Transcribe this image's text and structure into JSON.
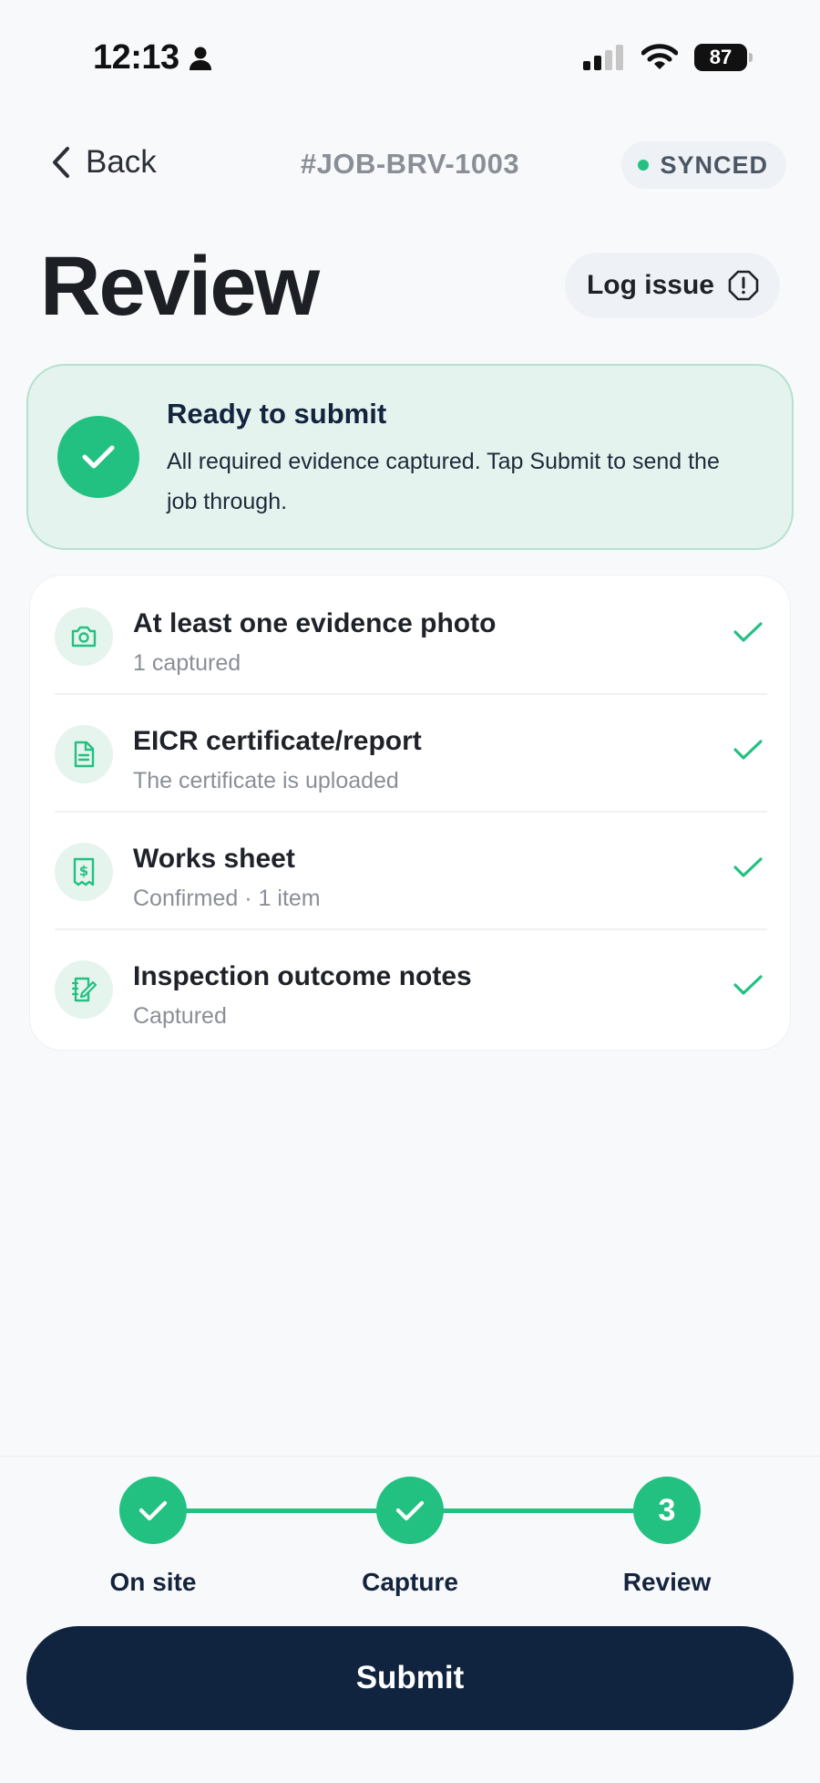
{
  "status_bar": {
    "time": "12:13",
    "battery": "87"
  },
  "header": {
    "back_label": "Back",
    "job_id": "#JOB-BRV-1003",
    "sync_status": "SYNCED",
    "title": "Review",
    "log_issue_label": "Log issue"
  },
  "banner": {
    "title": "Ready to submit",
    "body": "All required evidence captured. Tap Submit to send the job through."
  },
  "checklist": [
    {
      "label": "At least one evidence photo",
      "sub": "1 captured",
      "icon": "camera-icon",
      "done": true
    },
    {
      "label": "EICR certificate/report",
      "sub": "The certificate is uploaded",
      "icon": "document-icon",
      "done": true
    },
    {
      "label": "Works sheet",
      "sub": "Confirmed · 1 item",
      "icon": "receipt-icon",
      "done": true
    },
    {
      "label": "Inspection outcome notes",
      "sub": "Captured",
      "icon": "notebook-edit-icon",
      "done": true
    }
  ],
  "steps": [
    {
      "label": "On site",
      "state": "done"
    },
    {
      "label": "Capture",
      "state": "done"
    },
    {
      "label": "Review",
      "state": "current",
      "number": "3"
    }
  ],
  "submit_label": "Submit",
  "colors": {
    "accent": "#23c181",
    "primary": "#11243f",
    "banner_bg": "#e4f3ee",
    "background": "#f8f9fb"
  }
}
